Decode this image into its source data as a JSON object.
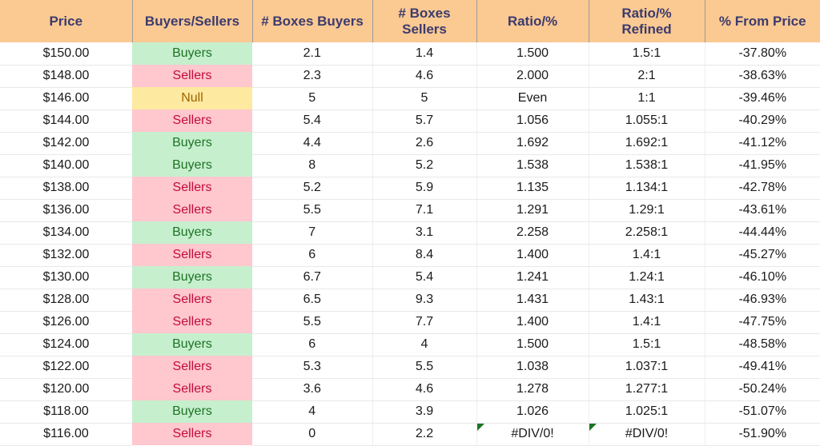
{
  "table": {
    "columns": [
      {
        "key": "price",
        "label": "Price"
      },
      {
        "key": "signal",
        "label": "Buyers/Sellers"
      },
      {
        "key": "boxes_buyers",
        "label": "# Boxes Buyers"
      },
      {
        "key": "boxes_sellers",
        "label": "# Boxes\nSellers"
      },
      {
        "key": "ratio",
        "label": "Ratio/%"
      },
      {
        "key": "ratio_refined",
        "label": "Ratio/%\nRefined"
      },
      {
        "key": "pct_from_price",
        "label": "% From Price"
      }
    ],
    "colors": {
      "header_bg": "#FBC992",
      "header_text": "#3B3B6E",
      "buyers_bg": "#C6EFCE",
      "buyers_text": "#1D7324",
      "sellers_bg": "#FFC7CE",
      "sellers_text": "#C00C3C",
      "null_bg": "#FDE9A0",
      "null_text": "#9C6500",
      "error_flag": "#1D7324",
      "grid": "#E8E8E8"
    },
    "rows": [
      {
        "price": "$150.00",
        "signal": "Buyers",
        "signal_state": "buyers",
        "boxes_buyers": "2.1",
        "boxes_sellers": "1.4",
        "ratio": "1.500",
        "ratio_refined": "1.5:1",
        "pct_from_price": "-37.80%",
        "ratio_error": false,
        "refined_error": false
      },
      {
        "price": "$148.00",
        "signal": "Sellers",
        "signal_state": "sellers",
        "boxes_buyers": "2.3",
        "boxes_sellers": "4.6",
        "ratio": "2.000",
        "ratio_refined": "2:1",
        "pct_from_price": "-38.63%",
        "ratio_error": false,
        "refined_error": false
      },
      {
        "price": "$146.00",
        "signal": "Null",
        "signal_state": "null",
        "boxes_buyers": "5",
        "boxes_sellers": "5",
        "ratio": "Even",
        "ratio_refined": "1:1",
        "pct_from_price": "-39.46%",
        "ratio_error": false,
        "refined_error": false
      },
      {
        "price": "$144.00",
        "signal": "Sellers",
        "signal_state": "sellers",
        "boxes_buyers": "5.4",
        "boxes_sellers": "5.7",
        "ratio": "1.056",
        "ratio_refined": "1.055:1",
        "pct_from_price": "-40.29%",
        "ratio_error": false,
        "refined_error": false
      },
      {
        "price": "$142.00",
        "signal": "Buyers",
        "signal_state": "buyers",
        "boxes_buyers": "4.4",
        "boxes_sellers": "2.6",
        "ratio": "1.692",
        "ratio_refined": "1.692:1",
        "pct_from_price": "-41.12%",
        "ratio_error": false,
        "refined_error": false
      },
      {
        "price": "$140.00",
        "signal": "Buyers",
        "signal_state": "buyers",
        "boxes_buyers": "8",
        "boxes_sellers": "5.2",
        "ratio": "1.538",
        "ratio_refined": "1.538:1",
        "pct_from_price": "-41.95%",
        "ratio_error": false,
        "refined_error": false
      },
      {
        "price": "$138.00",
        "signal": "Sellers",
        "signal_state": "sellers",
        "boxes_buyers": "5.2",
        "boxes_sellers": "5.9",
        "ratio": "1.135",
        "ratio_refined": "1.134:1",
        "pct_from_price": "-42.78%",
        "ratio_error": false,
        "refined_error": false
      },
      {
        "price": "$136.00",
        "signal": "Sellers",
        "signal_state": "sellers",
        "boxes_buyers": "5.5",
        "boxes_sellers": "7.1",
        "ratio": "1.291",
        "ratio_refined": "1.29:1",
        "pct_from_price": "-43.61%",
        "ratio_error": false,
        "refined_error": false
      },
      {
        "price": "$134.00",
        "signal": "Buyers",
        "signal_state": "buyers",
        "boxes_buyers": "7",
        "boxes_sellers": "3.1",
        "ratio": "2.258",
        "ratio_refined": "2.258:1",
        "pct_from_price": "-44.44%",
        "ratio_error": false,
        "refined_error": false
      },
      {
        "price": "$132.00",
        "signal": "Sellers",
        "signal_state": "sellers",
        "boxes_buyers": "6",
        "boxes_sellers": "8.4",
        "ratio": "1.400",
        "ratio_refined": "1.4:1",
        "pct_from_price": "-45.27%",
        "ratio_error": false,
        "refined_error": false
      },
      {
        "price": "$130.00",
        "signal": "Buyers",
        "signal_state": "buyers",
        "boxes_buyers": "6.7",
        "boxes_sellers": "5.4",
        "ratio": "1.241",
        "ratio_refined": "1.24:1",
        "pct_from_price": "-46.10%",
        "ratio_error": false,
        "refined_error": false
      },
      {
        "price": "$128.00",
        "signal": "Sellers",
        "signal_state": "sellers",
        "boxes_buyers": "6.5",
        "boxes_sellers": "9.3",
        "ratio": "1.431",
        "ratio_refined": "1.43:1",
        "pct_from_price": "-46.93%",
        "ratio_error": false,
        "refined_error": false
      },
      {
        "price": "$126.00",
        "signal": "Sellers",
        "signal_state": "sellers",
        "boxes_buyers": "5.5",
        "boxes_sellers": "7.7",
        "ratio": "1.400",
        "ratio_refined": "1.4:1",
        "pct_from_price": "-47.75%",
        "ratio_error": false,
        "refined_error": false
      },
      {
        "price": "$124.00",
        "signal": "Buyers",
        "signal_state": "buyers",
        "boxes_buyers": "6",
        "boxes_sellers": "4",
        "ratio": "1.500",
        "ratio_refined": "1.5:1",
        "pct_from_price": "-48.58%",
        "ratio_error": false,
        "refined_error": false
      },
      {
        "price": "$122.00",
        "signal": "Sellers",
        "signal_state": "sellers",
        "boxes_buyers": "5.3",
        "boxes_sellers": "5.5",
        "ratio": "1.038",
        "ratio_refined": "1.037:1",
        "pct_from_price": "-49.41%",
        "ratio_error": false,
        "refined_error": false
      },
      {
        "price": "$120.00",
        "signal": "Sellers",
        "signal_state": "sellers",
        "boxes_buyers": "3.6",
        "boxes_sellers": "4.6",
        "ratio": "1.278",
        "ratio_refined": "1.277:1",
        "pct_from_price": "-50.24%",
        "ratio_error": false,
        "refined_error": false
      },
      {
        "price": "$118.00",
        "signal": "Buyers",
        "signal_state": "buyers",
        "boxes_buyers": "4",
        "boxes_sellers": "3.9",
        "ratio": "1.026",
        "ratio_refined": "1.025:1",
        "pct_from_price": "-51.07%",
        "ratio_error": false,
        "refined_error": false
      },
      {
        "price": "$116.00",
        "signal": "Sellers",
        "signal_state": "sellers",
        "boxes_buyers": "0",
        "boxes_sellers": "2.2",
        "ratio": "#DIV/0!",
        "ratio_refined": "#DIV/0!",
        "pct_from_price": "-51.90%",
        "ratio_error": true,
        "refined_error": true
      }
    ]
  }
}
